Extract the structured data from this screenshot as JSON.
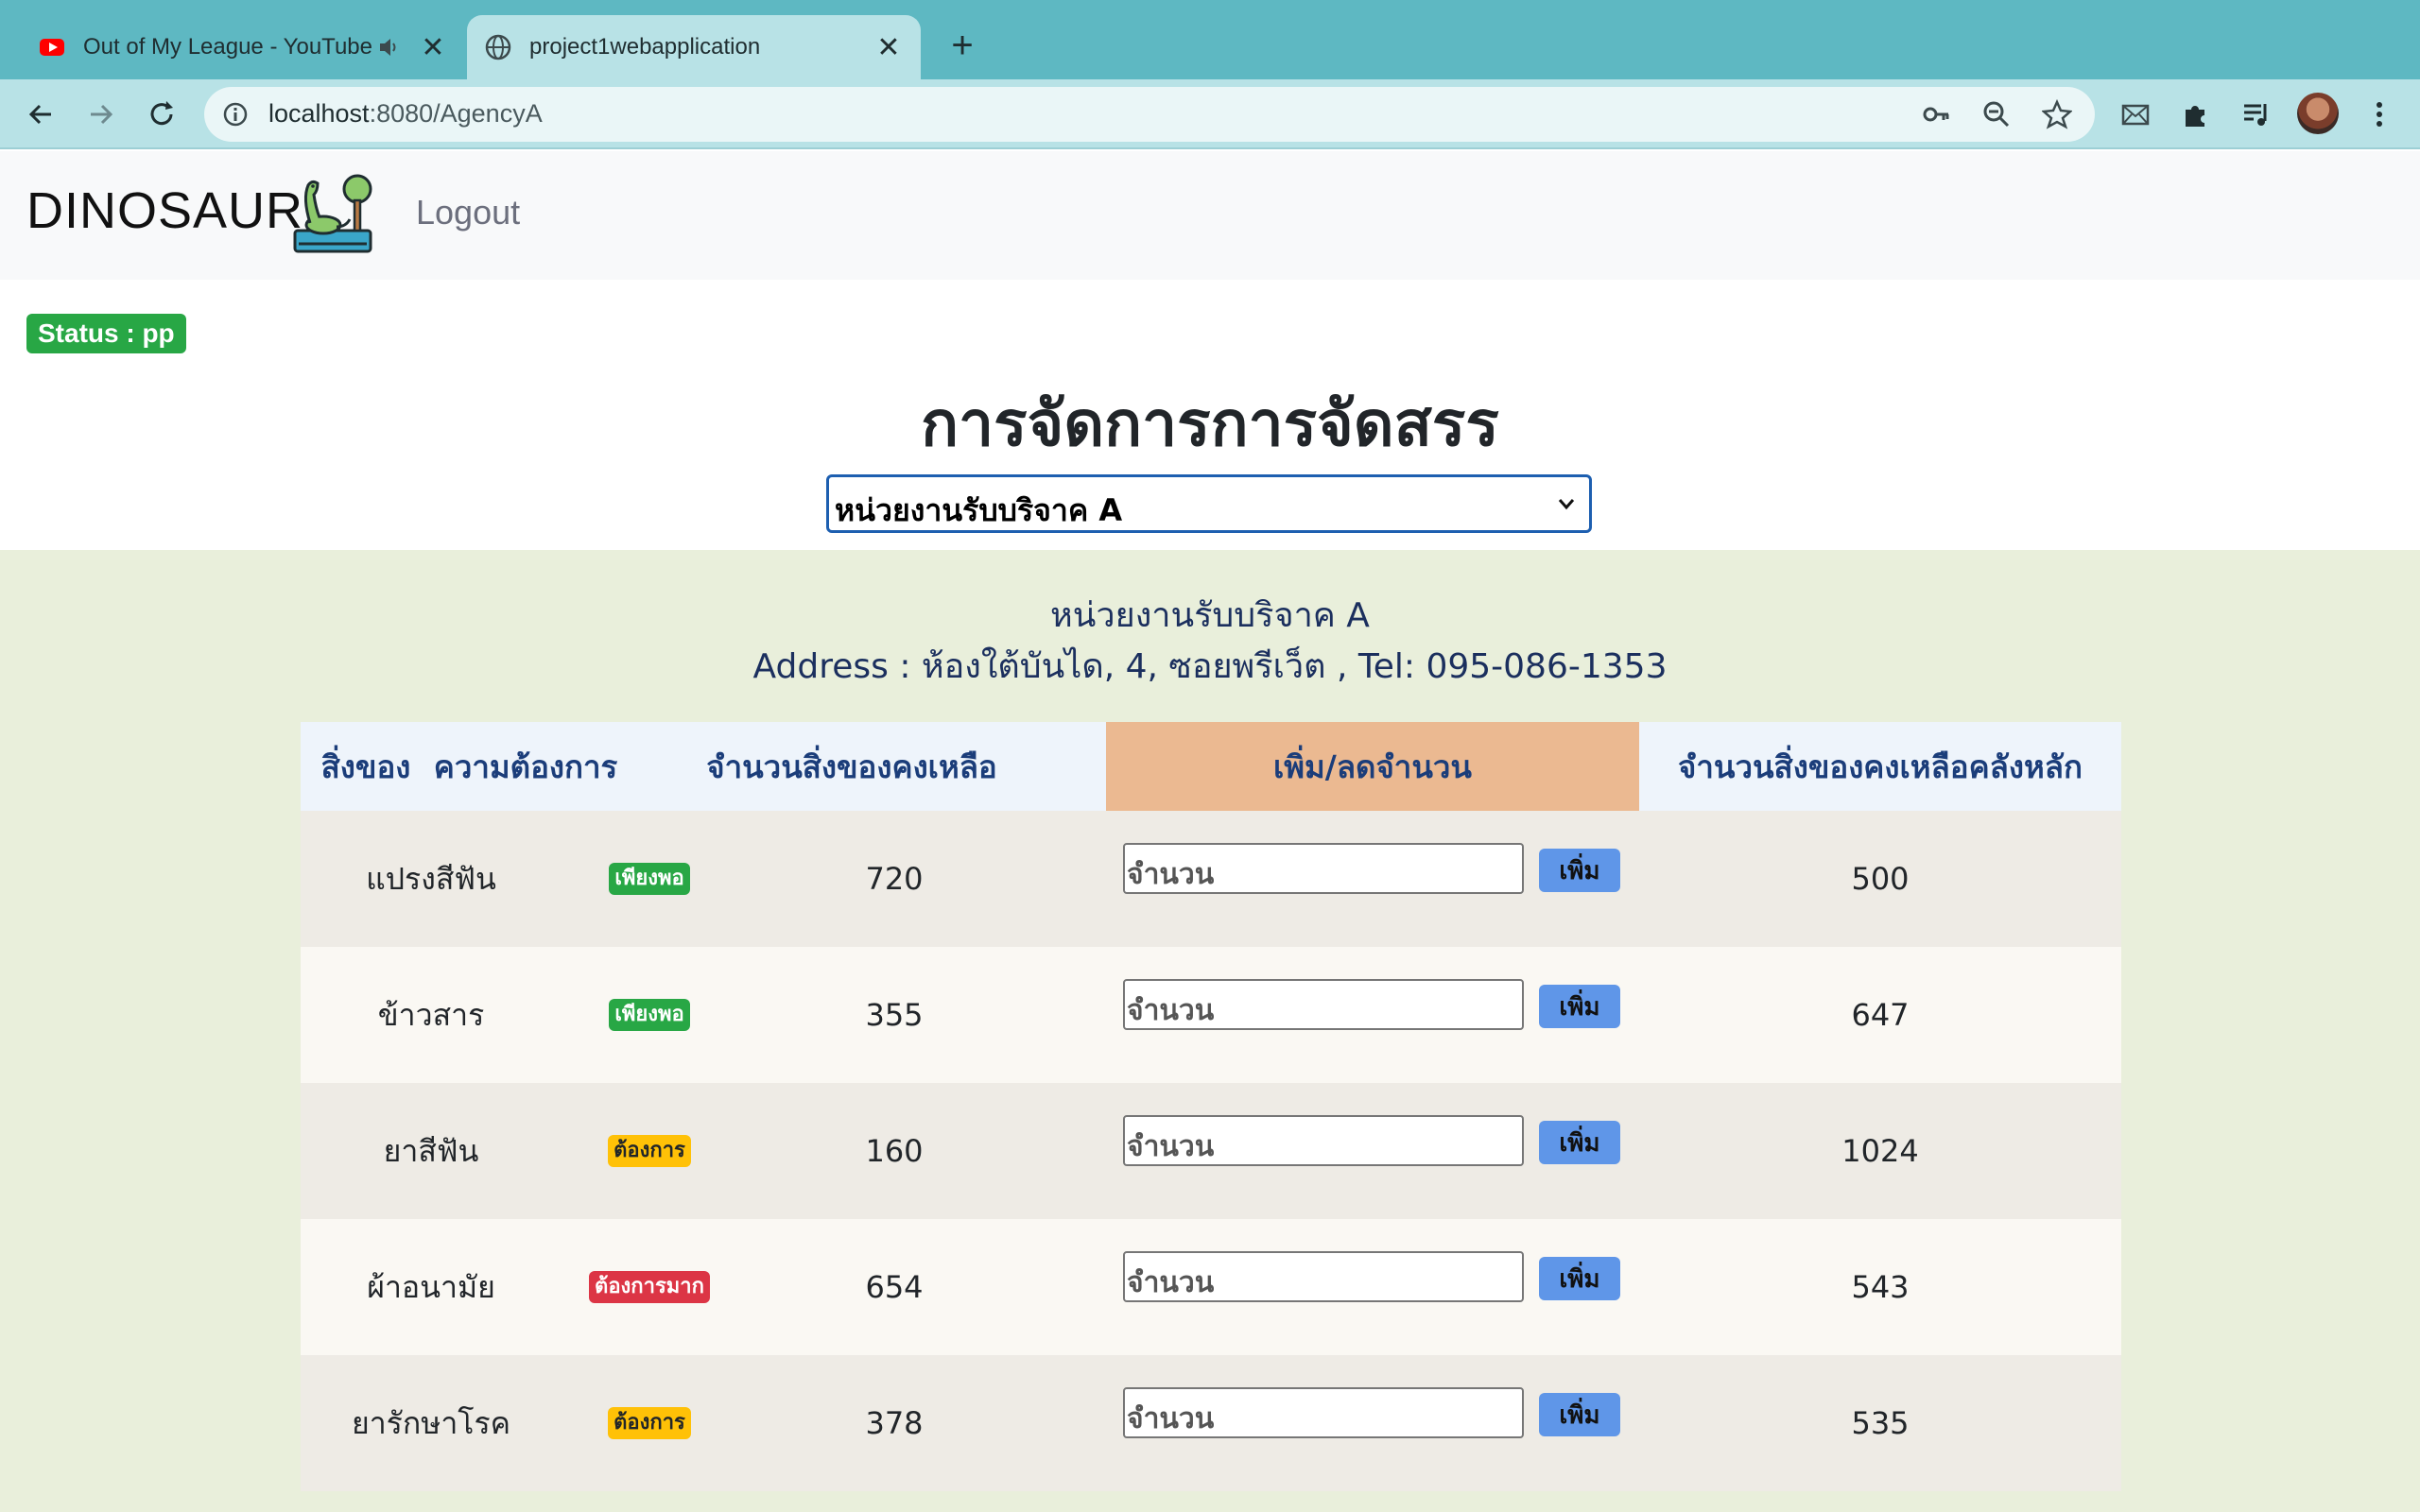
{
  "browser": {
    "tabs": [
      {
        "title": "Out of My League - YouTube",
        "active": false,
        "audible": true
      },
      {
        "title": "project1webapplication",
        "active": true,
        "audible": false
      }
    ],
    "url_host": "localhost",
    "url_path": ":8080/AgencyA",
    "icons": [
      "back-icon",
      "forward-icon",
      "reload-icon",
      "info-icon",
      "key-icon",
      "zoom-out-icon",
      "star-icon",
      "mail-icon",
      "extensions-icon",
      "media-icon",
      "menu-icon"
    ]
  },
  "navbar": {
    "brand": "DINOSAUR",
    "logout": "Logout"
  },
  "status": "Status : pp",
  "heading": "การจัดการการจัดสรร",
  "agency_select": {
    "selected": "หน่วยงานรับบริจาค A"
  },
  "agency": {
    "name": "หน่วยงานรับบริจาค A",
    "address": "Address : ห้องใต้บันได, 4, ซอยพรีเว็ต , Tel: 095-086-1353"
  },
  "table": {
    "headers": {
      "item": "สิ่งของ",
      "need": "ความต้องการ",
      "remaining": "จำนวนสิ่งของคงเหลือ",
      "adjust": "เพิ่ม/ลดจำนวน",
      "main_stock": "จำนวนสิ่งของคงเหลือคลังหลัก"
    },
    "input_placeholder": "จำนวน",
    "add_label": "เพิ่ม",
    "rows": [
      {
        "item": "แปรงสีฟัน",
        "need": "เพียงพอ",
        "need_level": "ok",
        "remaining": "720",
        "main_stock": "500"
      },
      {
        "item": "ข้าวสาร",
        "need": "เพียงพอ",
        "need_level": "ok",
        "remaining": "355",
        "main_stock": "647"
      },
      {
        "item": "ยาสีฟัน",
        "need": "ต้องการ",
        "need_level": "want",
        "remaining": "160",
        "main_stock": "1024"
      },
      {
        "item": "ผ้าอนามัย",
        "need": "ต้องการมาก",
        "need_level": "urgent",
        "remaining": "654",
        "main_stock": "543"
      },
      {
        "item": "ยารักษาโรค",
        "need": "ต้องการ",
        "need_level": "want",
        "remaining": "378",
        "main_stock": "535"
      }
    ]
  },
  "colors": {
    "tab_strip": "#5eb8c2",
    "toolbar": "#b8e2e6",
    "content_bg": "#e9efdb",
    "adjust_header": "#ebb991",
    "status_badge": "#28a745",
    "add_button": "#5f96e8"
  }
}
